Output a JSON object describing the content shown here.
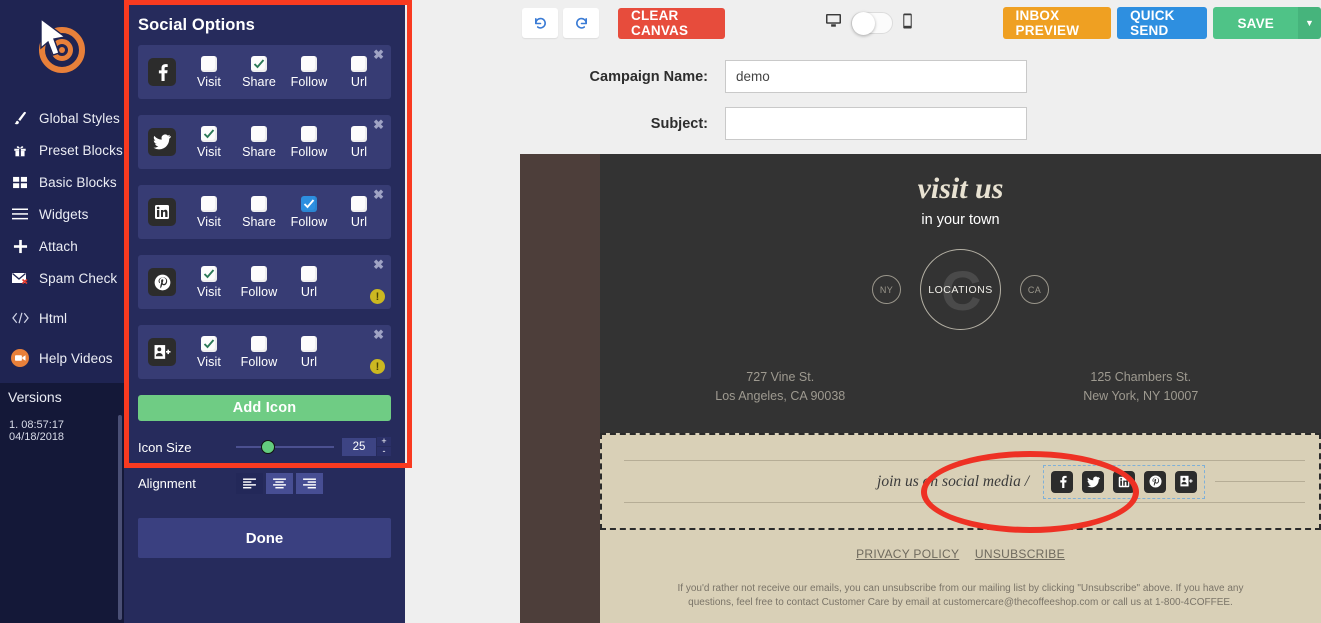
{
  "sidebar": {
    "logo_name": "target-cursor-logo",
    "items": [
      {
        "label": "Global Styles",
        "icon": "brush-icon"
      },
      {
        "label": "Preset Blocks",
        "icon": "gift-icon"
      },
      {
        "label": "Basic Blocks",
        "icon": "grid-icon"
      },
      {
        "label": "Widgets",
        "icon": "hamburger-icon"
      },
      {
        "label": "Attach",
        "icon": "plus-icon"
      },
      {
        "label": "Spam Check",
        "icon": "envelope-icon"
      },
      {
        "label": "Html",
        "icon": "code-icon"
      },
      {
        "label": "Help Videos",
        "icon": "video-camera-icon"
      }
    ],
    "versions_title": "Versions",
    "versions": [
      "1. 08:57:17 04/18/2018"
    ]
  },
  "options_panel": {
    "title": "Social Options",
    "rows": [
      {
        "network": "facebook",
        "glyph": "f",
        "options": [
          {
            "label": "Visit",
            "checked": false,
            "style": "green"
          },
          {
            "label": "Share",
            "checked": true,
            "style": "green"
          },
          {
            "label": "Follow",
            "checked": false,
            "style": "green"
          },
          {
            "label": "Url",
            "checked": false,
            "style": "green"
          }
        ],
        "warning": false
      },
      {
        "network": "twitter",
        "glyph": "bird",
        "options": [
          {
            "label": "Visit",
            "checked": true,
            "style": "green"
          },
          {
            "label": "Share",
            "checked": false,
            "style": "green"
          },
          {
            "label": "Follow",
            "checked": false,
            "style": "green"
          },
          {
            "label": "Url",
            "checked": false,
            "style": "green"
          }
        ],
        "warning": false
      },
      {
        "network": "linkedin",
        "glyph": "in",
        "options": [
          {
            "label": "Visit",
            "checked": false,
            "style": "green"
          },
          {
            "label": "Share",
            "checked": false,
            "style": "green"
          },
          {
            "label": "Follow",
            "checked": true,
            "style": "blue"
          },
          {
            "label": "Url",
            "checked": false,
            "style": "green"
          }
        ],
        "warning": false
      },
      {
        "network": "pinterest",
        "glyph": "p",
        "options": [
          {
            "label": "Visit",
            "checked": true,
            "style": "green"
          },
          {
            "label": "Follow",
            "checked": false,
            "style": "green"
          },
          {
            "label": "Url",
            "checked": false,
            "style": "green"
          }
        ],
        "warning": true
      },
      {
        "network": "googleplus",
        "glyph": "g",
        "options": [
          {
            "label": "Visit",
            "checked": true,
            "style": "green"
          },
          {
            "label": "Follow",
            "checked": false,
            "style": "green"
          },
          {
            "label": "Url",
            "checked": false,
            "style": "green"
          }
        ],
        "warning": true
      }
    ],
    "add_icon_label": "Add Icon",
    "icon_size_label": "Icon Size",
    "icon_size_value": "25",
    "plus_label": "+",
    "minus_label": "-",
    "alignment_label": "Alignment",
    "alignment_selected": "left",
    "done_label": "Done",
    "close_glyph": "✖",
    "warning_glyph": "!"
  },
  "toolbar": {
    "undo_glyph": "↺",
    "redo_glyph": "↻",
    "clear_canvas_label": "CLEAR CANVAS",
    "desktop_icon": "desktop-icon",
    "mobile_icon": "mobile-icon",
    "device_toggle_state": "desktop",
    "inbox_preview_label": "INBOX PREVIEW",
    "quick_send_label": "QUICK SEND",
    "save_label": "SAVE",
    "save_caret_glyph": "▼"
  },
  "meta": {
    "campaign_label": "Campaign Name:",
    "campaign_value": "demo",
    "campaign_placeholder": "",
    "subject_label": "Subject:",
    "subject_value": "",
    "subject_placeholder": ""
  },
  "email": {
    "visit_title": "visit us",
    "visit_subtitle": "in your town",
    "loc_left": "NY",
    "loc_center": "LOCATIONS",
    "loc_center_watermark": "C",
    "loc_right": "CA",
    "address_left_line1": "727 Vine St.",
    "address_left_line2": "Los Angeles, CA 90038",
    "address_right_line1": "125 Chambers St.",
    "address_right_line2": "New York, NY 10007",
    "join_text": "join us on social media /",
    "social_icons": [
      "facebook",
      "twitter",
      "linkedin",
      "pinterest",
      "googleplus"
    ],
    "privacy_label": "PRIVACY POLICY",
    "unsubscribe_label": "UNSUBSCRIBE",
    "legal_text": "If you'd rather not receive our emails, you can unsubscribe from our mailing list by clicking \"Unsubscribe\" above. If you have any questions, feel free to contact Customer Care by email at customercare@thecoffeeshop.com or call us at 1-800-4COFFEE."
  },
  "colors": {
    "nav_bg": "#1f2452",
    "panel_bg": "#262b5c",
    "selection_red": "#f93a20",
    "add_icon_green": "#6fcc84",
    "clear_red": "#e74c3c",
    "inbox_orange": "#efa022",
    "quick_blue": "#2e8fe0",
    "save_green": "#4fc387",
    "canvas_dark": "#333333",
    "canvas_brown": "#4d3e3a",
    "footer_tan": "#d9d0b7",
    "annotation_red": "#ee3124"
  }
}
